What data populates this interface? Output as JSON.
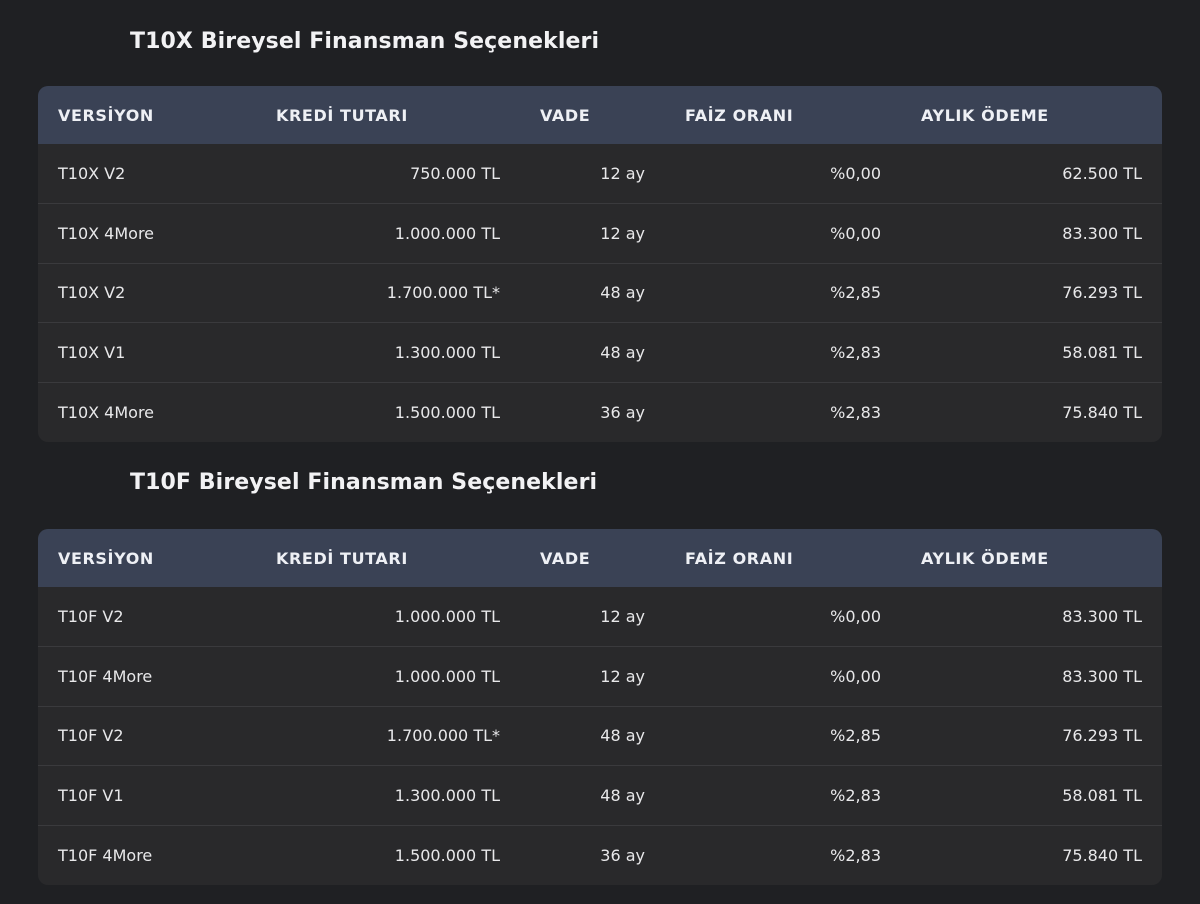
{
  "sections": [
    {
      "title": "T10X Bireysel Finansman Seçenekleri",
      "headers": [
        "VERSİYON",
        "KREDİ TUTARI",
        "VADE",
        "FAİZ ORANI",
        "AYLIK ÖDEME"
      ],
      "rows": [
        [
          "T10X V2",
          "750.000 TL",
          "12 ay",
          "%0,00",
          "62.500 TL"
        ],
        [
          "T10X 4More",
          "1.000.000 TL",
          "12 ay",
          "%0,00",
          "83.300 TL"
        ],
        [
          "T10X V2",
          "1.700.000 TL*",
          "48 ay",
          "%2,85",
          "76.293 TL"
        ],
        [
          "T10X V1",
          "1.300.000 TL",
          "48 ay",
          "%2,83",
          "58.081 TL"
        ],
        [
          "T10X 4More",
          "1.500.000 TL",
          "36 ay",
          "%2,83",
          "75.840 TL"
        ]
      ]
    },
    {
      "title": "T10F Bireysel Finansman Seçenekleri",
      "headers": [
        "VERSİYON",
        "KREDİ TUTARI",
        "VADE",
        "FAİZ ORANI",
        "AYLIK ÖDEME"
      ],
      "rows": [
        [
          "T10F V2",
          "1.000.000 TL",
          "12 ay",
          "%0,00",
          "83.300 TL"
        ],
        [
          "T10F 4More",
          "1.000.000 TL",
          "12 ay",
          "%0,00",
          "83.300 TL"
        ],
        [
          "T10F V2",
          "1.700.000 TL*",
          "48 ay",
          "%2,85",
          "76.293 TL"
        ],
        [
          "T10F V1",
          "1.300.000 TL",
          "48 ay",
          "%2,83",
          "58.081 TL"
        ],
        [
          "T10F 4More",
          "1.500.000 TL",
          "36 ay",
          "%2,83",
          "75.840 TL"
        ]
      ]
    }
  ],
  "colors": {
    "background": "#1f2023",
    "table_body": "#29292b",
    "table_header": "#3a4255",
    "row_divider": "#3a3a3d",
    "text": "#e8e8ea"
  }
}
